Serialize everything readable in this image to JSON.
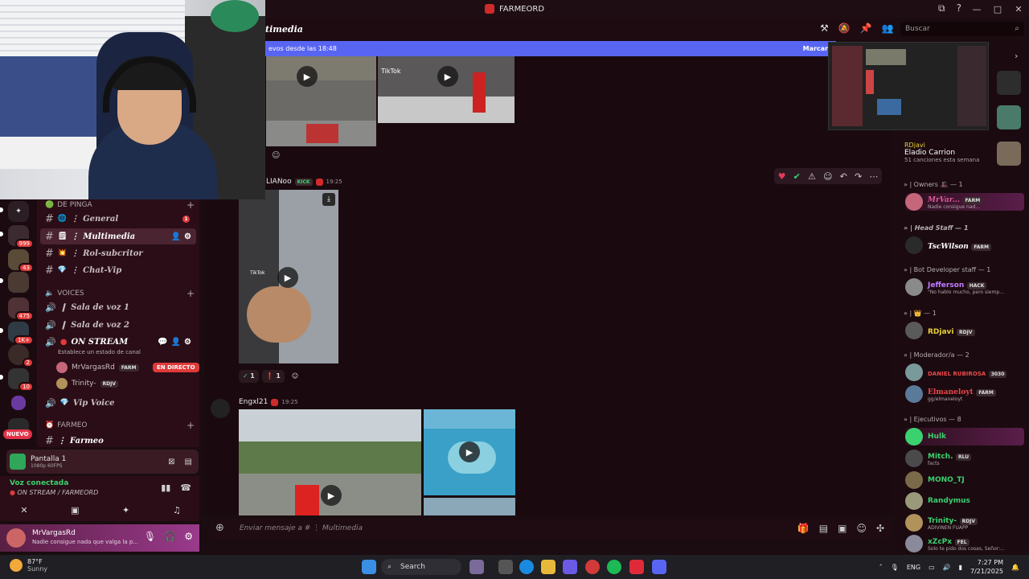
{
  "window": {
    "title": "FARMEORD",
    "controls": [
      "—",
      "□",
      "✕"
    ]
  },
  "servers": [
    {
      "badge": ""
    },
    {
      "badge": "999"
    },
    {
      "badge": "43"
    },
    {
      "badge": ""
    },
    {
      "badge": "475"
    },
    {
      "badge": "1K+"
    },
    {
      "badge": "2"
    },
    {
      "badge": "10"
    },
    {
      "badge": ""
    }
  ],
  "server_new_label": "NUEVO",
  "sidebar": {
    "category1": "DE PINGA",
    "category_voices": "VOICES",
    "category_farmeo": "FARMEO",
    "channels": [
      {
        "name": "General",
        "emoji": "🌐",
        "unread": "1"
      },
      {
        "name": "Multimedia",
        "emoji": "🗒"
      },
      {
        "name": "Rol-subcritor",
        "emoji": "💥"
      },
      {
        "name": "Chat-Vip",
        "emoji": "💎"
      }
    ],
    "voice_channels": [
      {
        "name": "Sala de voz 1"
      },
      {
        "name": "Sala de voz 2"
      },
      {
        "name": "ON STREAM"
      }
    ],
    "stream_status": "Establece un estado de canal",
    "voice_users": [
      {
        "name": "MrVargasRd",
        "tag": "FARM",
        "live": "EN DIRECTO"
      },
      {
        "name": "Trinity-",
        "tag": "RDJV"
      }
    ],
    "vip_voice": "Vip Voice",
    "farmeo_channel": "Farmeo"
  },
  "screen_share": {
    "title": "Pantalla 1",
    "subtitle": "1080p 60FPS"
  },
  "voice_connection": {
    "status": "Voz conectada",
    "channel": "ON STREAM / FARMEORD"
  },
  "user": {
    "name": "MrVargasRd",
    "status": "Nadie consigue nada que valga la p..."
  },
  "header": {
    "channel": "Multimedia",
    "partial_channel": "timedia"
  },
  "search_placeholder": "Buscar",
  "new_messages": {
    "text": "evos desde las 18:48",
    "mark": "Marcar"
  },
  "messages": [
    {
      "author": "LIANoo",
      "tag": "KICK",
      "time": "19:25"
    },
    {
      "author": "Engxl21",
      "time": "19:25"
    }
  ],
  "reactions": [
    {
      "emoji": "✓",
      "count": "1"
    },
    {
      "emoji": "❗",
      "count": "1"
    }
  ],
  "tiktok": "TikTok",
  "composer_placeholder": "Enviar mensaje a #  ⋮ Multimedia",
  "music": {
    "user": "RDjavi",
    "track": "Eladio Carrion",
    "count": "51 canciones esta semana"
  },
  "member_groups": [
    {
      "label": "» | Owners 🎩 — 1"
    },
    {
      "label": "» | Head Staff — 1"
    },
    {
      "label": "» | Bot Developer staff — 1"
    },
    {
      "label": "» | 👑 — 1"
    },
    {
      "label": "» | Moderador/a — 2"
    },
    {
      "label": "» | Ejecutivos — 8"
    }
  ],
  "members": [
    {
      "name": "MrVar...",
      "tag": "FARM",
      "status": "Nadie consigue nad...",
      "color": "#e05a9a"
    },
    {
      "name": "TscWilson",
      "tag": "FARM",
      "status": "",
      "color": "#ffffff"
    },
    {
      "name": "Jefferson",
      "tag": "HACK",
      "status": "\"No hablo mucho, pero siemp...",
      "color": "#c07cff"
    },
    {
      "name": "RDjavi",
      "tag": "RDJV",
      "status": "",
      "color": "#e8d03a"
    },
    {
      "name": "DANIEL RUBIROSA",
      "tag": "3030",
      "status": "",
      "color": "#e84a4a"
    },
    {
      "name": "Elmaneloyt",
      "tag": "FARM",
      "status": "gg/elmaneloyt",
      "color": "#e84a4a"
    },
    {
      "name": "Hulk",
      "tag": "",
      "status": "",
      "color": "#3bd16f"
    },
    {
      "name": "Mitch.",
      "tag": "RLU",
      "status": "facts",
      "color": "#3bd16f"
    },
    {
      "name": "MONO_TJ",
      "tag": "",
      "status": "",
      "color": "#3bd16f"
    },
    {
      "name": "Randymus",
      "tag": "",
      "status": "",
      "color": "#3bd16f"
    },
    {
      "name": "Trinity-",
      "tag": "RDJV",
      "status": "ADIVINEN FUAPP",
      "color": "#3bd16f"
    },
    {
      "name": "xZcPx",
      "tag": "FEL",
      "status": "Solo te pido dos cosas, Señor:...",
      "color": "#3bd16f"
    }
  ],
  "taskbar": {
    "temp": "87°F",
    "weather": "Sunny",
    "search": "Search",
    "lang": "ENG",
    "time": "7:27 PM",
    "date": "7/21/2025"
  },
  "colors": {
    "accent": "#5865f2",
    "live": "#e03a3a",
    "online": "#3bd16f"
  }
}
